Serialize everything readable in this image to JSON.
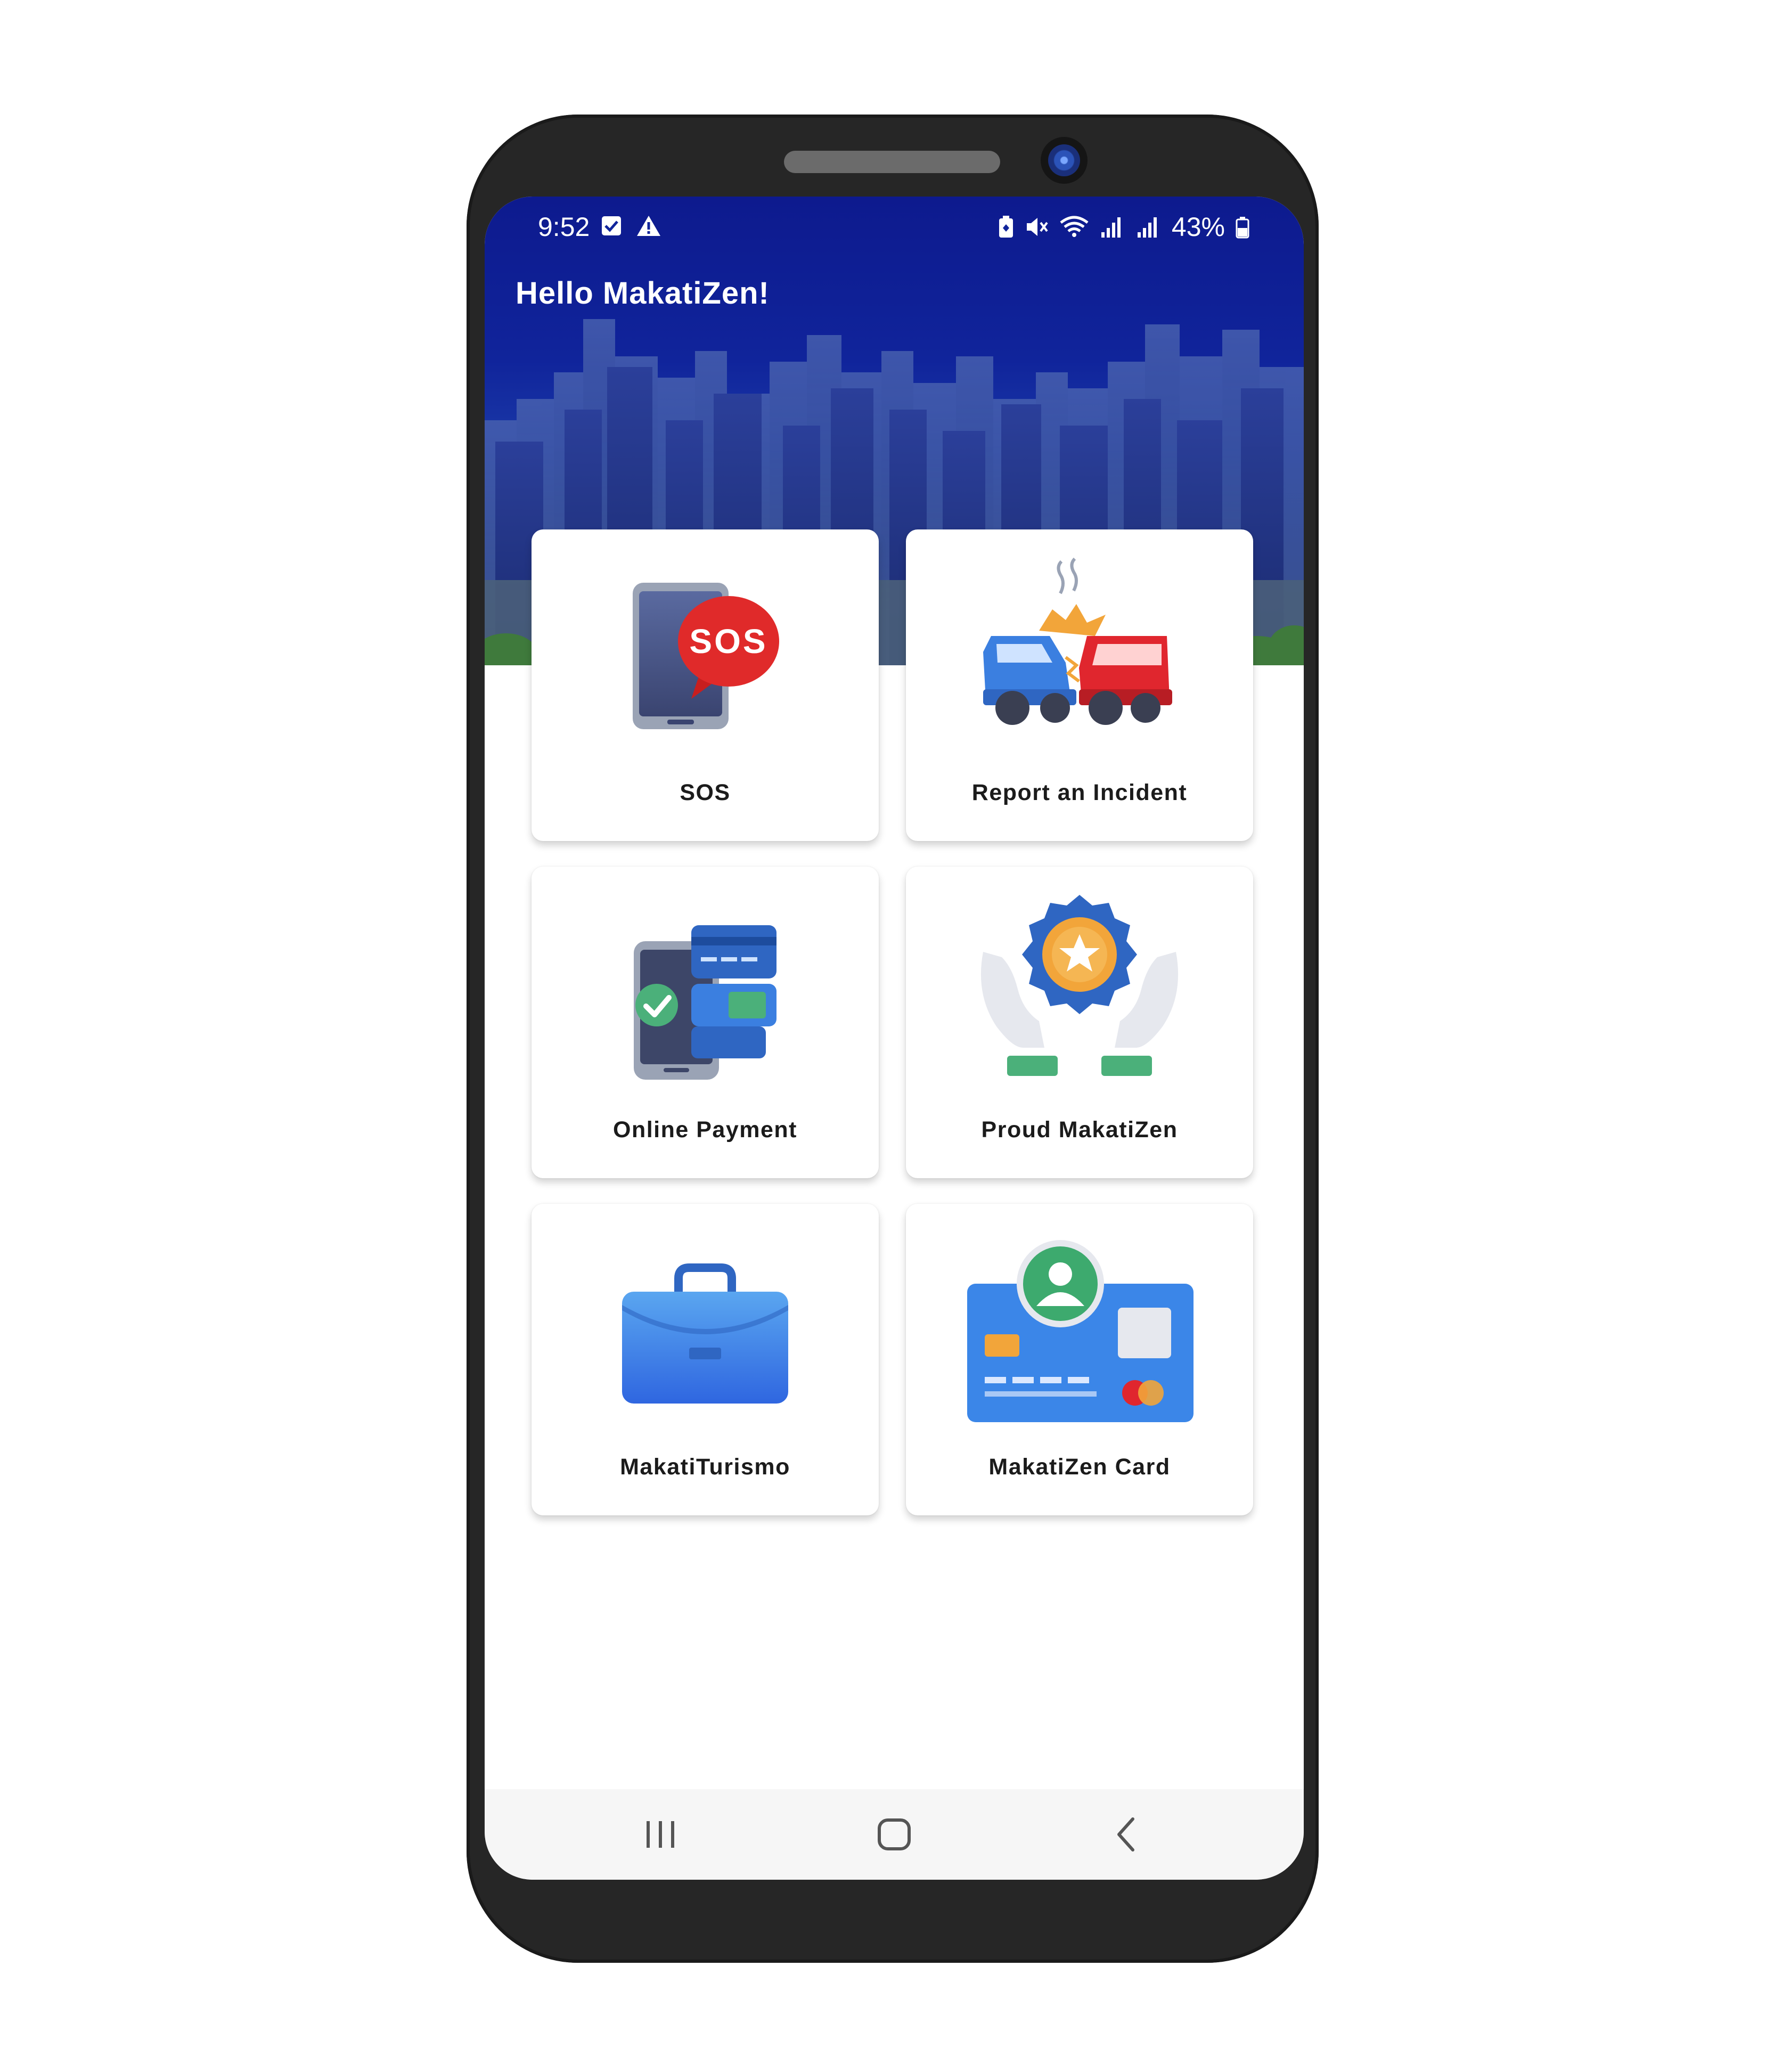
{
  "status_bar": {
    "time": "9:52",
    "left_icons": [
      "checkbox-icon",
      "warning-icon"
    ],
    "right_icons": [
      "battery-saver-icon",
      "mute-icon",
      "wifi-icon",
      "signal-icon",
      "signal-icon"
    ],
    "battery": "43%"
  },
  "header": {
    "greeting": "Hello MakatiZen!"
  },
  "tiles": [
    {
      "label": "SOS",
      "icon": "sos-phone-icon"
    },
    {
      "label": "Report an Incident",
      "icon": "car-crash-icon"
    },
    {
      "label": "Online Payment",
      "icon": "payment-card-icon"
    },
    {
      "label": "Proud MakatiZen",
      "icon": "award-hands-icon"
    },
    {
      "label": "MakatiTurismo",
      "icon": "briefcase-icon"
    },
    {
      "label": "MakatiZen Card",
      "icon": "id-card-icon"
    }
  ],
  "nav_bar": [
    "recent-apps-icon",
    "home-icon",
    "back-icon"
  ],
  "colors": {
    "header_blue": "#10249b",
    "tile_label": "#1b1b1b",
    "sos_red": "#e02a2a"
  }
}
